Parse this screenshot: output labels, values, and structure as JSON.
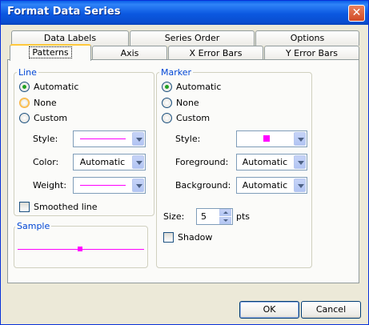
{
  "window": {
    "title": "Format Data Series",
    "close_glyph": "✕"
  },
  "tabs": {
    "row_back": [
      "Data Labels",
      "Series Order",
      "Options"
    ],
    "row_front": [
      "Patterns",
      "Axis",
      "X Error Bars",
      "Y Error Bars"
    ],
    "active": "Patterns"
  },
  "line": {
    "group_label": "Line",
    "options": [
      "Automatic",
      "None",
      "Custom"
    ],
    "selected": "Automatic",
    "style_label": "Style:",
    "color_label": "Color:",
    "color_value": "Automatic",
    "weight_label": "Weight:",
    "smoothed_label": "Smoothed line",
    "smoothed_checked": false,
    "line_color": "#FF00FF"
  },
  "sample": {
    "group_label": "Sample",
    "color": "#FF00FF"
  },
  "marker": {
    "group_label": "Marker",
    "options": [
      "Automatic",
      "None",
      "Custom"
    ],
    "selected": "Automatic",
    "style_label": "Style:",
    "foreground_label": "Foreground:",
    "foreground_value": "Automatic",
    "background_label": "Background:",
    "background_value": "Automatic",
    "size_label": "Size:",
    "size_value": "5",
    "size_unit": "pts",
    "shadow_label": "Shadow",
    "shadow_checked": false,
    "marker_color": "#FF00FF"
  },
  "buttons": {
    "ok": "OK",
    "cancel": "Cancel"
  }
}
